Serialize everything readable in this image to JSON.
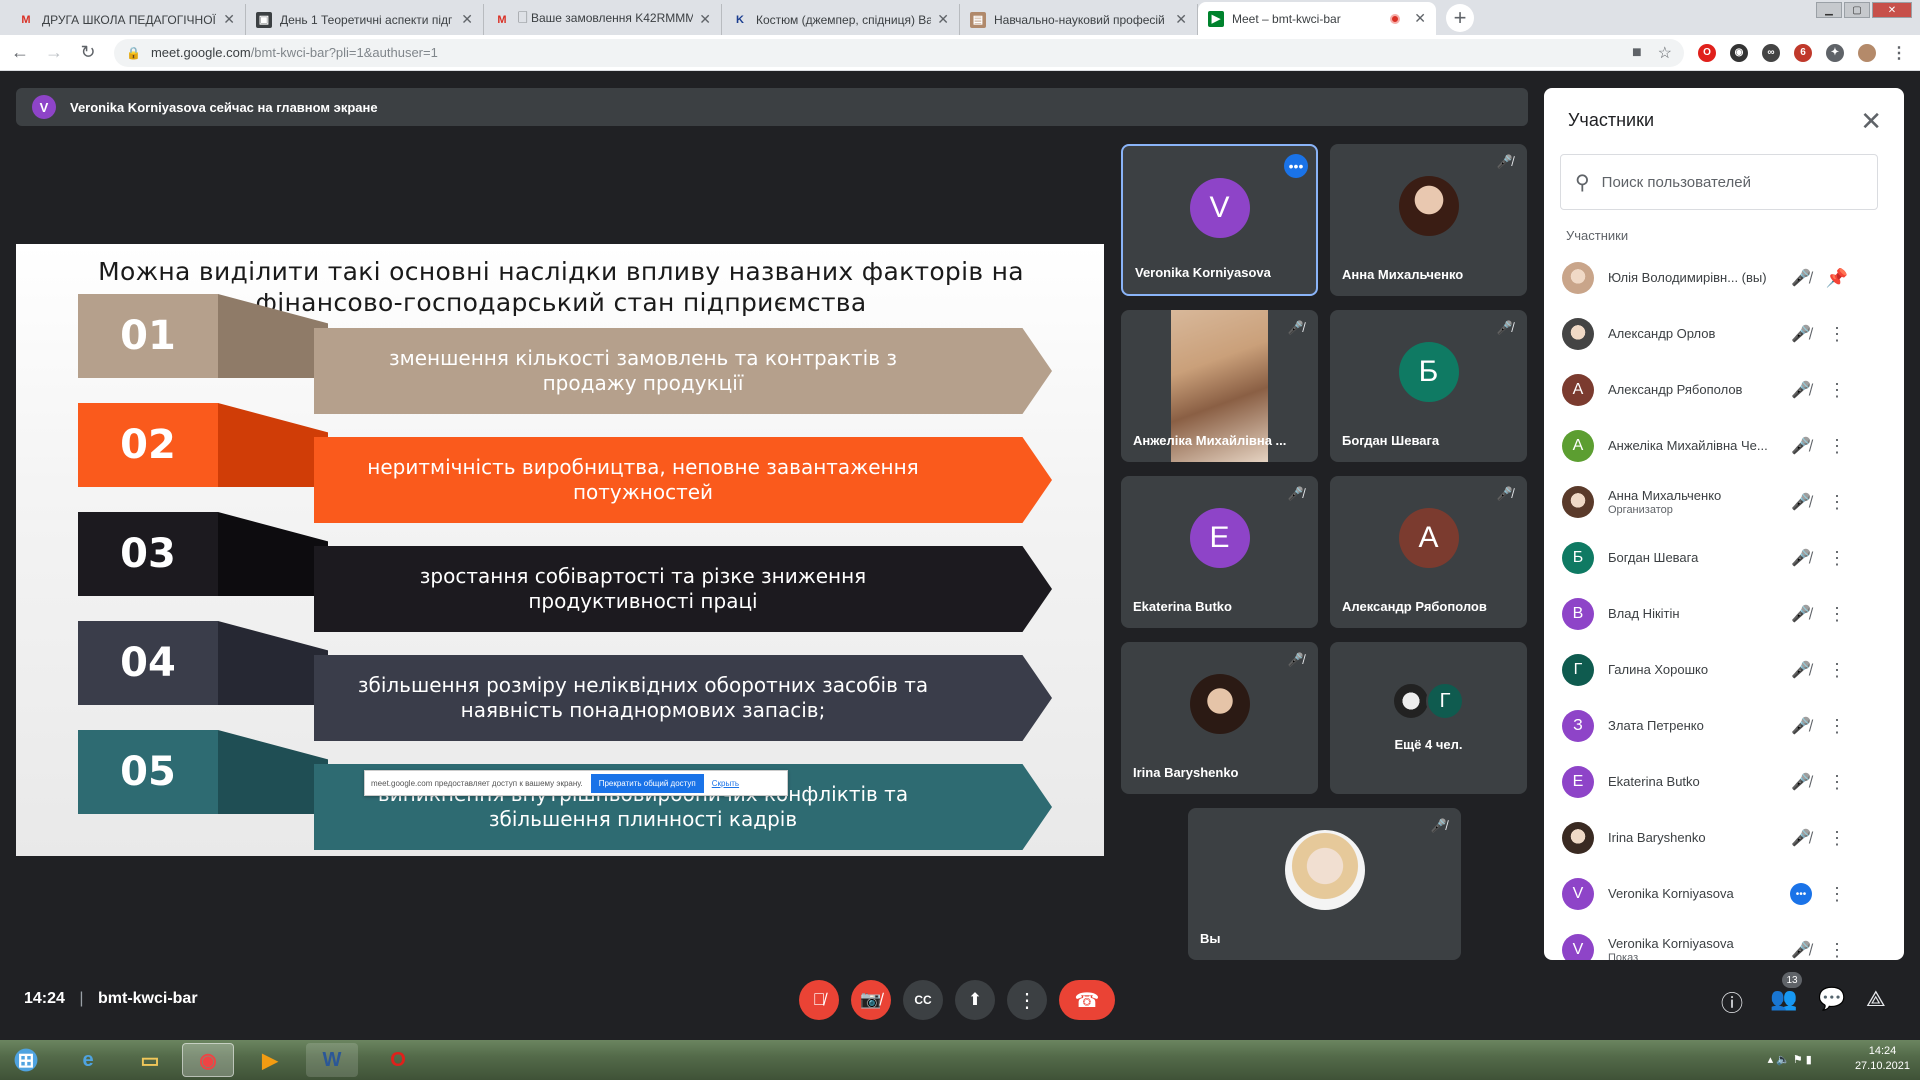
{
  "browser": {
    "tabs": [
      {
        "icon": "gmail-icon",
        "title": "ДРУГА ШКОЛА ПЕДАГОГІЧНОЇ М"
      },
      {
        "icon": "classroom-icon",
        "title": "День 1 Теоретичні аспекти підг"
      },
      {
        "icon": "gmail-icon",
        "title": "🗌 Ваше замовлення K42RMMM"
      },
      {
        "icon": "k-icon",
        "title": "Костюм (джемпер, спідниця) Ва"
      },
      {
        "icon": "doc-icon",
        "title": "Навчально-науковий професій"
      },
      {
        "icon": "meet-icon",
        "title": "Meet – bmt-kwci-bar",
        "active": true
      }
    ],
    "url_host": "meet.google.com",
    "url_path": "/bmt-kwci-bar?pli=1&authuser=1"
  },
  "banner": {
    "avatar_letter": "V",
    "text": "Veronika Korniyasova сейчас на главном экране"
  },
  "slide": {
    "title": "Можна виділити такі основні наслідки впливу названих факторів на фінансово-господарський стан підприємства",
    "items": [
      {
        "num": "01",
        "text": "зменшення кількості замовлень та контрактів з продажу продукції",
        "color": "#b5a08c",
        "fold": "#8f7b68"
      },
      {
        "num": "02",
        "text": "неритмічність виробництва, неповне завантаження потужностей",
        "color": "#fa5a1c",
        "fold": "#d03d07"
      },
      {
        "num": "03",
        "text": "зростання собівартості та різке зниження продуктивності праці",
        "color": "#1c1a1f",
        "fold": "#0d0c0f"
      },
      {
        "num": "04",
        "text": "збільшення розміру неліквідних оборотних засобів та наявність понаднормових запасів;",
        "color": "#3a3d4a",
        "fold": "#262833"
      },
      {
        "num": "05",
        "text": "виникнення внутрішньовиробничих конфліктів та збільшення плинності кадрів",
        "color": "#2e6b72",
        "fold": "#1f4e54"
      }
    ],
    "share_notice": {
      "text": "meet.google.com предоставляет доступ к вашему экрану.",
      "stop": "Прекратить общий доступ",
      "hide": "Скрыть"
    }
  },
  "tiles": [
    {
      "name": "Veronika Korniyasova",
      "letter": "V",
      "color": "#8e44c8"
    },
    {
      "name": "Анна Михальченко",
      "photo": true
    },
    {
      "name": "Анжеліка Михайлівна ...",
      "video": true
    },
    {
      "name": "Богдан Шевага",
      "letter": "Б",
      "color": "#0f7a63"
    },
    {
      "name": "Ekaterina Butko",
      "letter": "E",
      "color": "#8e44c8"
    },
    {
      "name": "Александр Рябополов",
      "letter": "А",
      "color": "#7b3b2f"
    },
    {
      "name": "Irina Baryshenko",
      "photo": true
    },
    {
      "name": "Ещё 4 чел.",
      "letter": "Г",
      "color": "#0f5b4f"
    },
    {
      "name": "Вы",
      "photo": true
    }
  ],
  "panel": {
    "title": "Участники",
    "search_placeholder": "Поиск пользователей",
    "section_label": "Участники",
    "people": [
      {
        "name": "Юлія Володимирівн... (вы)",
        "avatar": "photo",
        "color": "#c9a58a",
        "action": "pin"
      },
      {
        "name": "Александр Орлов",
        "avatar": "photo",
        "color": "#444"
      },
      {
        "name": "Александр Рябополов",
        "avatar": "А",
        "color": "#7b3b2f"
      },
      {
        "name": "Анжеліка Михайлівна Че...",
        "avatar": "А",
        "color": "#5c9e31"
      },
      {
        "name": "Анна Михальченко",
        "sub": "Организатор",
        "avatar": "photo",
        "color": "#5a3a2a"
      },
      {
        "name": "Богдан Шевага",
        "avatar": "Б",
        "color": "#0f7a63"
      },
      {
        "name": "Влад Нікітін",
        "avatar": "В",
        "color": "#8e44c8"
      },
      {
        "name": "Галина Хорошко",
        "avatar": "Г",
        "color": "#0f5b4f"
      },
      {
        "name": "Злата Петренко",
        "avatar": "З",
        "color": "#8e44c8"
      },
      {
        "name": "Ekaterina Butko",
        "avatar": "E",
        "color": "#8e44c8"
      },
      {
        "name": "Irina Baryshenko",
        "avatar": "photo",
        "color": "#3a2a22"
      },
      {
        "name": "Veronika Korniyasova",
        "avatar": "V",
        "color": "#8e44c8",
        "speaking": true
      },
      {
        "name": "Veronika Korniyasova",
        "sub": "Показ",
        "avatar": "V",
        "color": "#8e44c8"
      }
    ]
  },
  "bottom": {
    "time": "14:24",
    "meeting_code": "bmt-kwci-bar",
    "participants_count": "13"
  },
  "taskbar": {
    "time": "14:24",
    "date": "27.10.2021"
  }
}
